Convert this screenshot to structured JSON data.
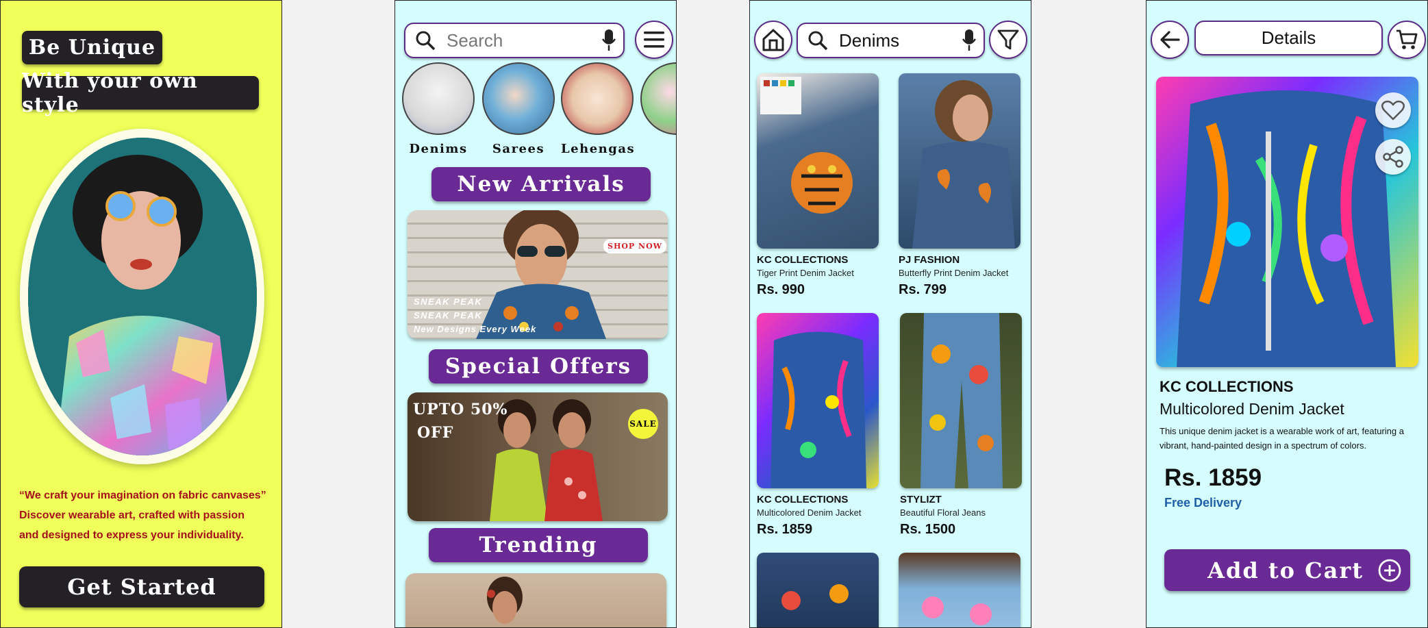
{
  "screen1": {
    "headline1": "Be Unique",
    "headline2": "With your own style",
    "quote": "“We craft your imagination on fabric canvases”",
    "desc1": "Discover wearable art, crafted with passion",
    "desc2": "and designed to express your individuality.",
    "cta": "Get Started",
    "colors": {
      "background": "#f0ff5a",
      "dark": "#232026",
      "quote": "#a5101a"
    }
  },
  "screen2": {
    "search_placeholder": "Search",
    "categories": [
      {
        "label": "Denims"
      },
      {
        "label": "Sarees"
      },
      {
        "label": "Lehengas"
      }
    ],
    "section1": "New Arrivals",
    "banner1": {
      "shop_now": "SHOP NOW",
      "line1": "SNEAK PEAK",
      "line2": "SNEAK PEAK",
      "line3": "New Designs Every Week"
    },
    "section2": "Special Offers",
    "banner2": {
      "offer1": "UPTO 50%",
      "offer2": "OFF",
      "badge": "SALE"
    },
    "section3": "Trending",
    "colors": {
      "background": "#d5fdfd",
      "accent": "#6a2a96"
    }
  },
  "screen3": {
    "search_value": "Denims",
    "products": [
      {
        "brand": "KC COLLECTIONS",
        "name": "Tiger Print Denim Jacket",
        "price": "Rs. 990"
      },
      {
        "brand": "PJ FASHION",
        "name": "Butterfly Print Denim Jacket",
        "price": "Rs. 799"
      },
      {
        "brand": "KC COLLECTIONS",
        "name": "Multicolored Denim Jacket",
        "price": "Rs. 1859"
      },
      {
        "brand": "STYLIZT",
        "name": "Beautiful Floral Jeans",
        "price": "Rs. 1500"
      }
    ]
  },
  "screen4": {
    "title": "Details",
    "brand": "KC COLLECTIONS",
    "name": "Multicolored Denim Jacket",
    "description": "This unique denim jacket is a wearable work of art, featuring a vibrant, hand-painted design in a spectrum of colors.",
    "price": "Rs. 1859",
    "delivery": "Free Delivery",
    "cta": "Add to Cart",
    "colors": {
      "delivery": "#1f5fa8",
      "accent": "#6a2a96"
    }
  }
}
